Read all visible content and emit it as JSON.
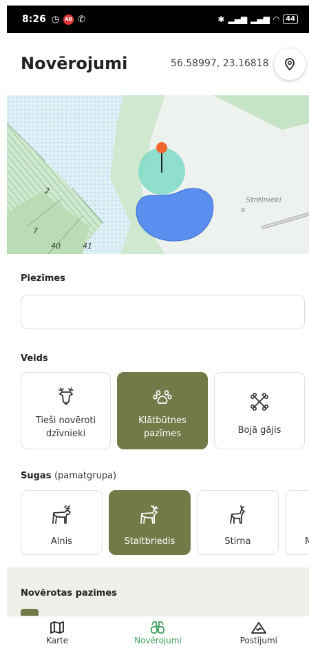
{
  "status_bar": {
    "time": "8:26",
    "battery": "44"
  },
  "header": {
    "title": "Novērojumi",
    "coordinates": "56.58997, 23.16818",
    "location_icon": "location-pin-icon"
  },
  "map": {
    "place_label": "Strēlnieki",
    "parcel_labels": [
      "2",
      "7",
      "40",
      "41"
    ],
    "colors": {
      "water": "#5a8ff0",
      "forest": "#c5e3c5",
      "marker": "#f0642d",
      "accuracy_circle": "#7fdac8"
    }
  },
  "notes": {
    "label": "Piezīmes",
    "value": "",
    "placeholder": ""
  },
  "type_section": {
    "label": "Veids",
    "options": [
      {
        "label": "Tieši novēroti dzīvnieki",
        "icon": "deer-head-icon",
        "selected": false
      },
      {
        "label": "Klātbūtnes pazīmes",
        "icon": "paw-print-icon",
        "selected": true
      },
      {
        "label": "Bojā gājis",
        "icon": "crossed-bones-icon",
        "selected": false
      }
    ]
  },
  "species_section": {
    "label": "Sugas",
    "sublabel": "(pamatgrupa)",
    "options": [
      {
        "label": "Alnis",
        "icon": "moose-icon",
        "selected": false
      },
      {
        "label": "Staltbriedis",
        "icon": "red-deer-icon",
        "selected": true
      },
      {
        "label": "Stirna",
        "icon": "roe-deer-icon",
        "selected": false
      },
      {
        "label": "M",
        "icon": "",
        "selected": false
      }
    ]
  },
  "observed_signs": {
    "label": "Novērotas pazīmes"
  },
  "bottom_nav": {
    "items": [
      {
        "label": "Karte",
        "icon": "map-icon",
        "active": false
      },
      {
        "label": "Novērojumi",
        "icon": "binoculars-icon",
        "active": true
      },
      {
        "label": "Postījumi",
        "icon": "mountain-icon",
        "active": false
      }
    ]
  },
  "colors": {
    "accent": "#737a48",
    "nav_active": "#3b9e5b"
  }
}
